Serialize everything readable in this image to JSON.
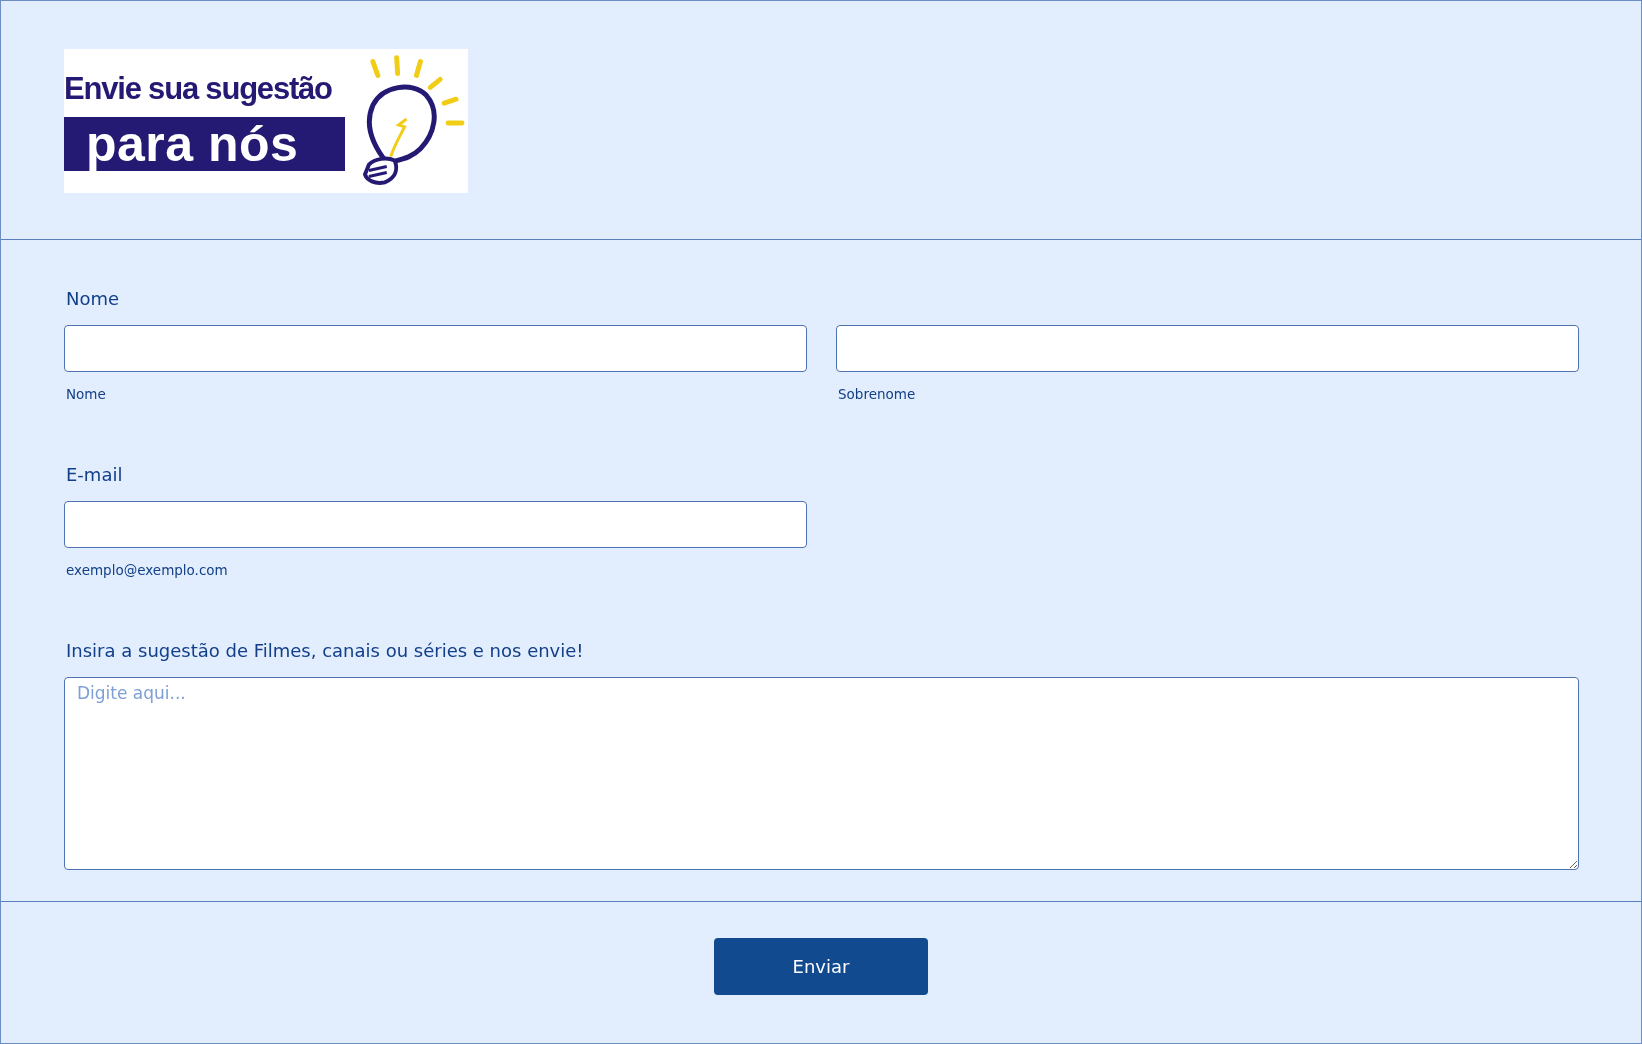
{
  "logo": {
    "line1": "Envie sua sugestão",
    "line2": "para nós"
  },
  "fields": [
    {
      "kind": "name",
      "label": "Nome",
      "subfields": [
        {
          "sublabel": "Nome"
        },
        {
          "sublabel": "Sobrenome"
        }
      ]
    },
    {
      "kind": "email",
      "label": "E-mail",
      "subfields": [
        {
          "sublabel": "exemplo@exemplo.com"
        }
      ]
    },
    {
      "kind": "textarea",
      "label": "Insira a sugestão de Filmes, canais ou séries e nos envie!",
      "placeholder": "Digite aqui..."
    }
  ],
  "submit": "Enviar"
}
